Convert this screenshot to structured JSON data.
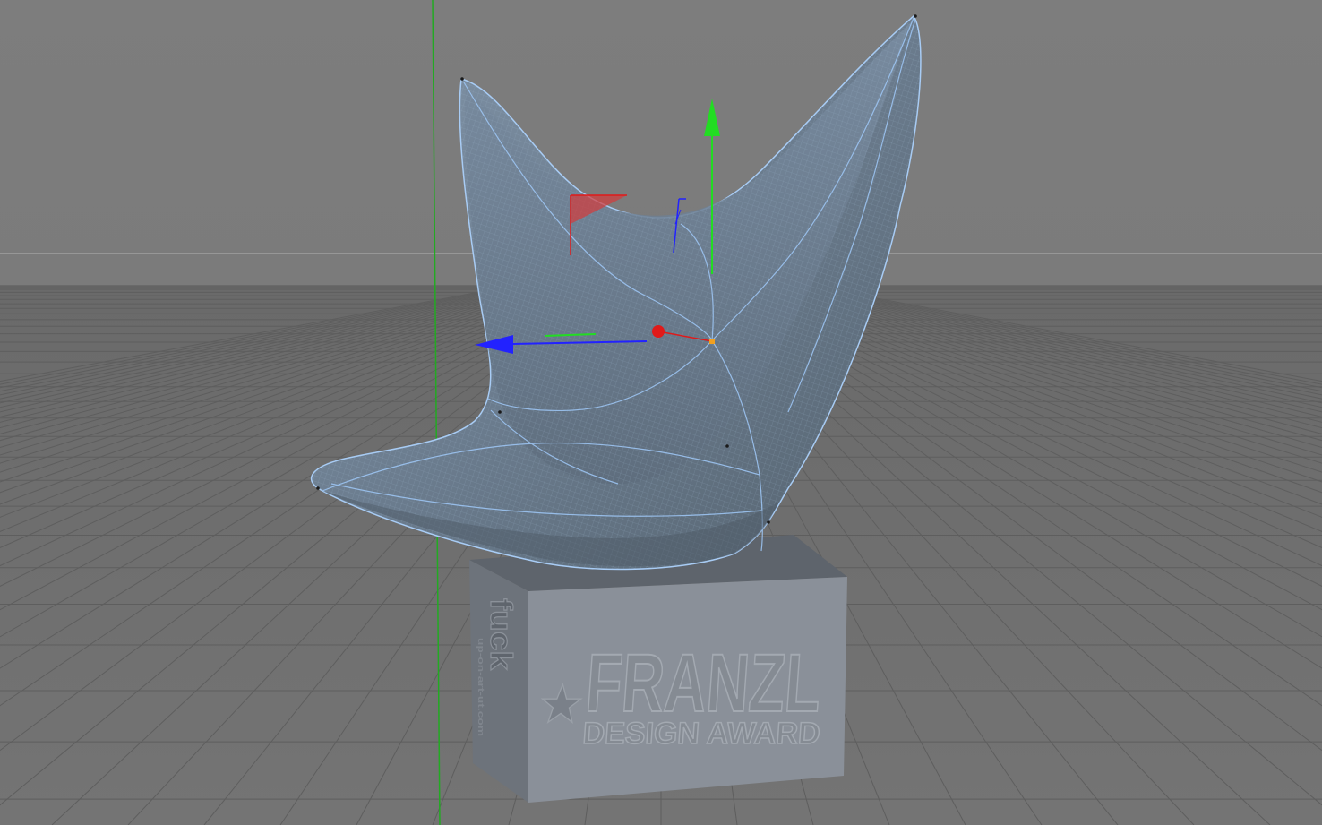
{
  "viewport": {
    "background_color": "#7b7b7b",
    "floor_color": "#6f6f6f",
    "grid_line_color": "#5e5e5e",
    "horizon_color": "#969696",
    "y_axis_line_color": "#22aa22"
  },
  "model": {
    "surface_color": "#6f7f90",
    "wire_color": "#8fb8e8",
    "edge_highlight_color": "#a8ccf5",
    "plinth_front_color": "#8a9099",
    "plinth_side_color": "#6d737b",
    "plinth_top_color": "#5d636b"
  },
  "plinth": {
    "front_title": "FRANZL",
    "front_subtitle": "DESIGN AWARD",
    "side_logo": "fuck",
    "side_subtext": "up-on-art-ut.com"
  },
  "gizmo": {
    "x_axis_color": "#e01a1a",
    "y_axis_color": "#22dd22",
    "z_axis_color": "#2222ff",
    "pivot_color": "#f0a020",
    "icons": [
      "move-y-arrow-icon",
      "move-z-arrow-icon",
      "move-x-handle-icon",
      "plane-xy-handle-icon",
      "plane-yz-handle-icon"
    ]
  }
}
